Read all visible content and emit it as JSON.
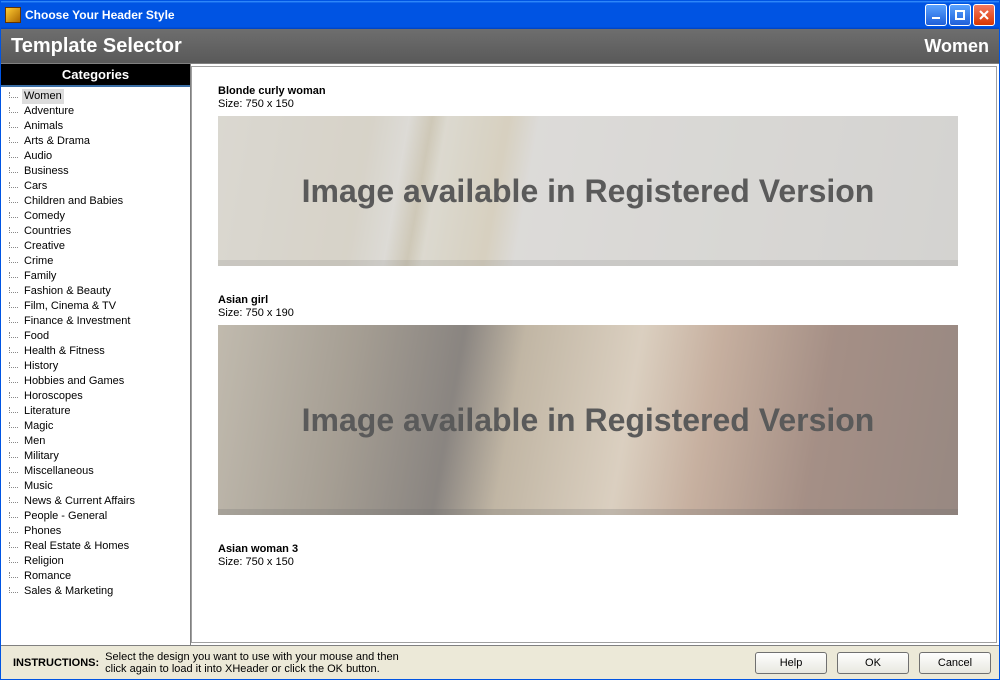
{
  "window": {
    "title": "Choose Your Header Style"
  },
  "header": {
    "title": "Template Selector",
    "current_category": "Women"
  },
  "sidebar": {
    "heading": "Categories",
    "selected": "Women",
    "items": [
      "Women",
      "Adventure",
      "Animals",
      "Arts & Drama",
      "Audio",
      "Business",
      "Cars",
      "Children and Babies",
      "Comedy",
      "Countries",
      "Creative",
      "Crime",
      "Family",
      "Fashion & Beauty",
      "Film, Cinema & TV",
      "Finance & Investment",
      "Food",
      "Health & Fitness",
      "History",
      "Hobbies and Games",
      "Horoscopes",
      "Literature",
      "Magic",
      "Men",
      "Military",
      "Miscellaneous",
      "Music",
      "News & Current Affairs",
      "People - General",
      "Phones",
      "Real Estate & Homes",
      "Religion",
      "Romance",
      "Sales & Marketing"
    ]
  },
  "templates": [
    {
      "name": "Blonde curly woman",
      "size_label": "Size: 750 x 150",
      "preview_class": "p1",
      "overlay": "Image available in Registered Version"
    },
    {
      "name": "Asian girl",
      "size_label": "Size: 750 x 190",
      "preview_class": "p2",
      "overlay": "Image available in Registered Version"
    },
    {
      "name": "Asian woman 3",
      "size_label": "Size: 750 x 150",
      "preview_class": "",
      "overlay": ""
    }
  ],
  "footer": {
    "instructions_label": "INSTRUCTIONS:",
    "instructions_text": "Select the design you want to use with your mouse and then\nclick again to load it into XHeader or click the OK button.",
    "help": "Help",
    "ok": "OK",
    "cancel": "Cancel"
  }
}
